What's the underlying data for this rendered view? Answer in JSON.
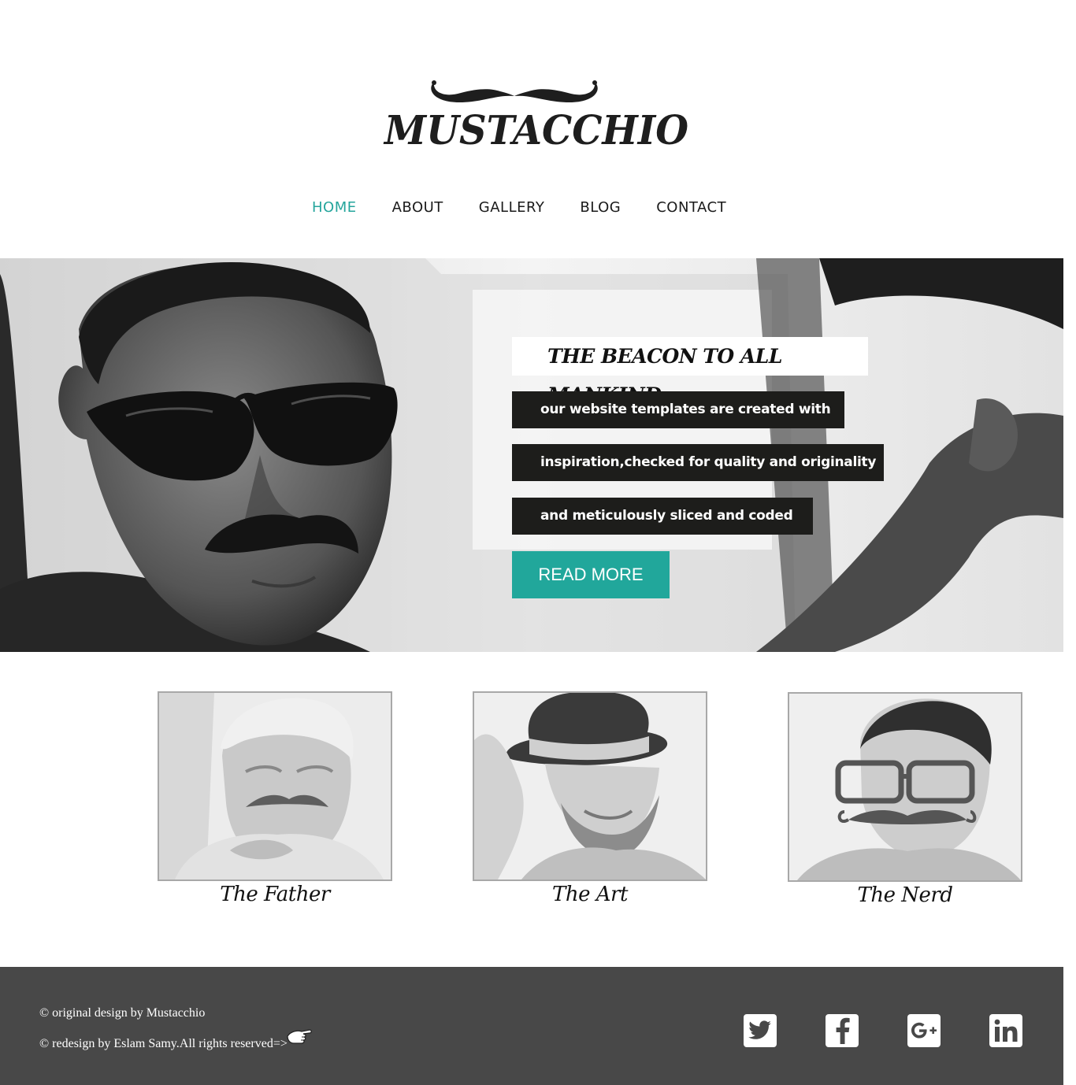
{
  "logo": {
    "text": "MUSTACCHIO"
  },
  "nav": {
    "items": [
      {
        "label": "HOME",
        "active": true
      },
      {
        "label": "ABOUT"
      },
      {
        "label": "GALLERY"
      },
      {
        "label": "BLOG"
      },
      {
        "label": "CONTACT"
      }
    ]
  },
  "hero": {
    "title": "THE BEACON TO ALL MANKIND",
    "lines": [
      "our website templates are created with",
      "inspiration,checked for quality and originality",
      "and meticulously sliced and coded"
    ],
    "button": "READ MORE"
  },
  "cards": [
    {
      "caption": "The Father"
    },
    {
      "caption": "The Art"
    },
    {
      "caption": "The Nerd"
    }
  ],
  "footer": {
    "credit1": "© original design by Mustacchio",
    "credit2": "© redesign by Eslam Samy.All rights reserved=>",
    "social": [
      "twitter-icon",
      "facebook-icon",
      "google-plus-icon",
      "linkedin-icon"
    ]
  },
  "colors": {
    "accent": "#21a79b",
    "footer": "#484848",
    "hero_box": "#1d1d1b"
  }
}
